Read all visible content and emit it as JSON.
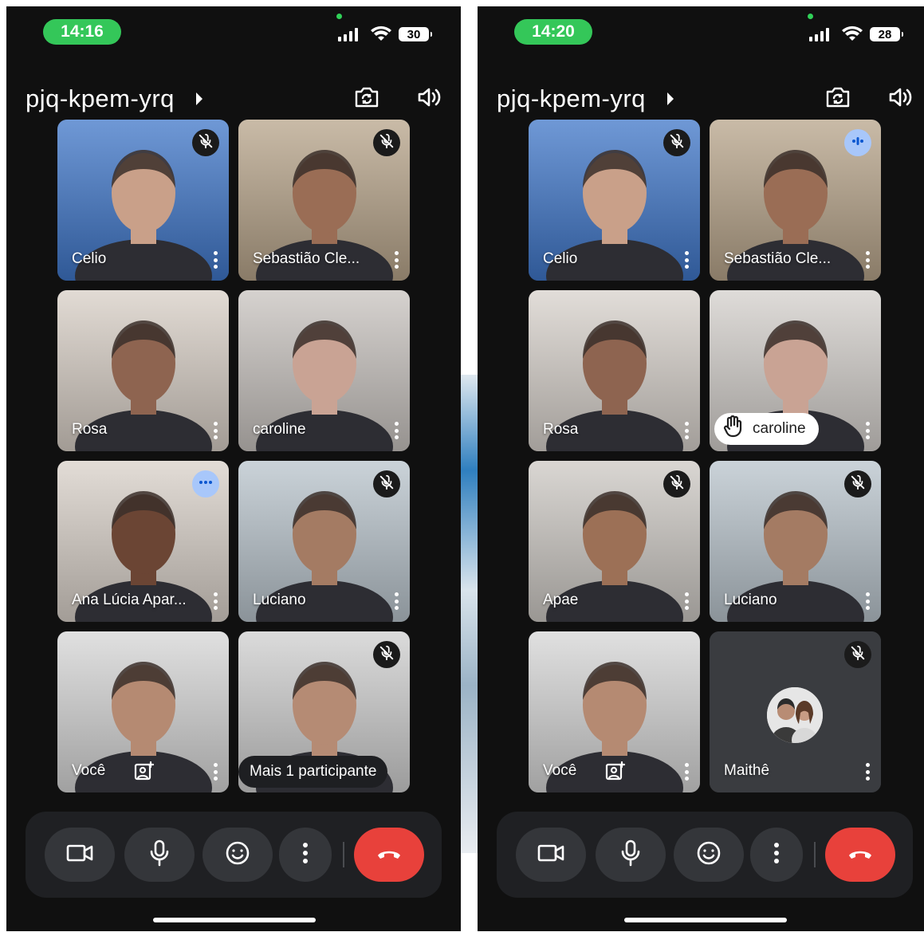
{
  "screens": [
    {
      "status": {
        "time": "14:16",
        "battery": "30"
      },
      "meeting_code": "pjq-kpem-yrq",
      "tiles": [
        {
          "name": "Celio",
          "badge": "mic-off-icon",
          "feed": "#3f76c8",
          "skin": "#c9a089"
        },
        {
          "name": "Sebastião Cle...",
          "badge": "mic-off-icon",
          "feed": "#b7a48a",
          "skin": "#9a6d55"
        },
        {
          "name": "Rosa",
          "badge": "",
          "feed": "#d8cfc6",
          "skin": "#8e6450"
        },
        {
          "name": "caroline",
          "badge": "",
          "feed": "#c8c3bf",
          "skin": "#c9a394"
        },
        {
          "name": "Ana Lúcia Apar...",
          "badge": "more-horiz-icon",
          "feed": "#d9d1c9",
          "skin": "#6b4534"
        },
        {
          "name": "Luciano",
          "badge": "mic-off-icon",
          "feed": "#b9c4cc",
          "skin": "#a47b63"
        },
        {
          "name": "Você",
          "badge": "",
          "feed": "#d6d6d6",
          "skin": "#b58a72",
          "self": true
        },
        {
          "name": "",
          "badge": "mic-off-icon",
          "feed": "#cfcfcf",
          "skin": "#b58b74",
          "more": "Mais 1 participante"
        }
      ]
    },
    {
      "status": {
        "time": "14:20",
        "battery": "28"
      },
      "meeting_code": "pjq-kpem-yrq",
      "tiles": [
        {
          "name": "Celio",
          "badge": "mic-off-icon",
          "feed": "#3f76c8",
          "skin": "#c9a089"
        },
        {
          "name": "Sebastião Cle...",
          "badge": "speaking-icon",
          "feed": "#b7a48a",
          "skin": "#9a6d55"
        },
        {
          "name": "Rosa",
          "badge": "",
          "feed": "#d8d2cc",
          "skin": "#8e6450"
        },
        {
          "name": "caroline",
          "badge": "",
          "feed": "#d4d0cc",
          "skin": "#c9a394",
          "hand": true
        },
        {
          "name": "Apae",
          "badge": "mic-off-icon",
          "feed": "#cdc9c4",
          "skin": "#9c7056"
        },
        {
          "name": "Luciano",
          "badge": "mic-off-icon",
          "feed": "#b9c4cc",
          "skin": "#a47b63"
        },
        {
          "name": "Você",
          "badge": "",
          "feed": "#d6d6d6",
          "skin": "#b58a72",
          "self": true
        },
        {
          "name": "Maithê",
          "badge": "mic-off-icon",
          "feed": "#3a3c40",
          "skin": "",
          "avatar": true
        }
      ]
    }
  ],
  "controls": [
    "camera-icon",
    "microphone-icon",
    "emoji-icon",
    "more-options-icon",
    "end-call-icon"
  ],
  "colors": {
    "status_pill": "#34c759",
    "end_call": "#e8413b",
    "talk_badge": "#a8c7fa",
    "tile_bg": "#3a3c40"
  }
}
